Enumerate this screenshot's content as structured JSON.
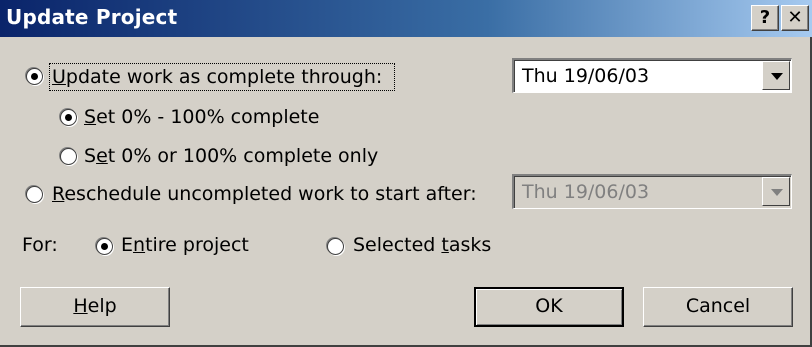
{
  "window": {
    "title": "Update Project",
    "help_glyph": "?",
    "close_glyph": "✕"
  },
  "update_option": {
    "mode_a_label": "Update work as complete through:",
    "mode_a_accel": "U",
    "mode_a_rest": "pdate work as complete through:",
    "mode_a_selected": true,
    "through_date": "Thu 19/06/03",
    "sub_a_prefix": "",
    "sub_a_accel": "S",
    "sub_a_rest": "et 0% - 100% complete",
    "sub_a_selected": true,
    "sub_b_prefix": "S",
    "sub_b_accel": "e",
    "sub_b_rest": "t 0% or 100% complete only",
    "sub_b_selected": false
  },
  "reschedule_option": {
    "accel": "R",
    "rest": "eschedule uncompleted work to start after:",
    "selected": false,
    "after_date": "Thu 19/06/03",
    "date_enabled": false
  },
  "scope": {
    "for_label": "For:",
    "entire_prefix": "E",
    "entire_accel": "n",
    "entire_rest": "tire project",
    "entire_selected": true,
    "selected_prefix": "Selected ",
    "selected_accel": "t",
    "selected_rest": "asks",
    "selected_selected": false
  },
  "buttons": {
    "help_accel": "H",
    "help_rest": "elp",
    "ok": "OK",
    "cancel": "Cancel"
  }
}
